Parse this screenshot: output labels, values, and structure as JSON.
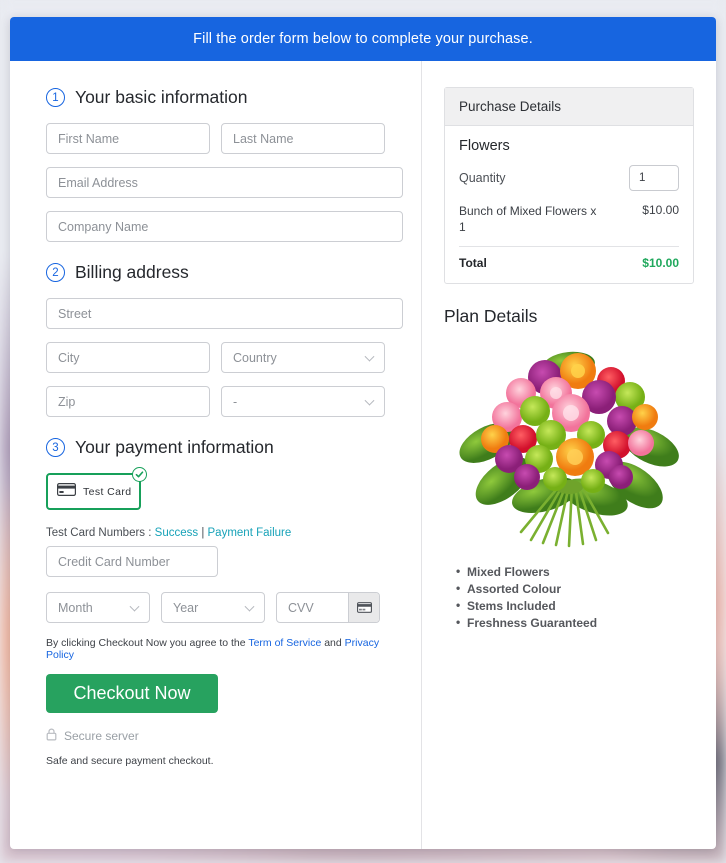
{
  "banner": {
    "text": "Fill the order form below to complete your purchase."
  },
  "colors": {
    "banner_blue": "#1765e0",
    "step_blue": "#1765e0",
    "success_green": "#27a25f",
    "total_green": "#1fa85c",
    "link_teal": "#17a2b8",
    "link_blue": "#1765e0",
    "card_border_green": "#17a05a"
  },
  "sections": {
    "basic": {
      "number": "1",
      "title": "Your basic information",
      "fields": {
        "first_name": "First Name",
        "last_name": "Last Name",
        "email": "Email Address",
        "company": "Company Name"
      }
    },
    "billing": {
      "number": "2",
      "title": "Billing address",
      "fields": {
        "street": "Street",
        "city": "City",
        "country": "Country",
        "zip": "Zip",
        "state": "-"
      }
    },
    "payment": {
      "number": "3",
      "title": "Your payment information",
      "card_tile_label": "Test Card",
      "card_tile_icon": "credit-card-icon",
      "selected_badge_icon": "check-circle-icon",
      "test_numbers_prefix": "Test Card Numbers : ",
      "test_success_link": "Success",
      "test_separator": " | ",
      "test_failure_link": "Payment Failure",
      "fields": {
        "card_number": "Credit Card Number",
        "month": "Month",
        "year": "Year",
        "cvv": "CVV"
      },
      "cvv_icon": "credit-card-icon"
    }
  },
  "terms": {
    "prefix": "By clicking Checkout Now you agree to the ",
    "tos_link": "Term of Service",
    "middle": " and ",
    "privacy_link": "Privacy Policy"
  },
  "checkout": {
    "button_label": "Checkout Now",
    "secure_icon": "lock-icon",
    "secure_label": "Secure server",
    "safe_note": "Safe and secure payment checkout."
  },
  "purchase": {
    "panel_title": "Purchase Details",
    "product_name": "Flowers",
    "quantity_label": "Quantity",
    "quantity_value": "1",
    "line_item_name": "Bunch of Mixed Flowers x 1",
    "line_item_amount": "$10.00",
    "total_label": "Total",
    "total_amount": "$10.00"
  },
  "plan": {
    "title": "Plan Details",
    "image_name": "bouquet-of-mixed-flowers-image",
    "features": [
      "Mixed Flowers",
      "Assorted Colour",
      "Stems Included",
      "Freshness Guaranteed"
    ]
  }
}
